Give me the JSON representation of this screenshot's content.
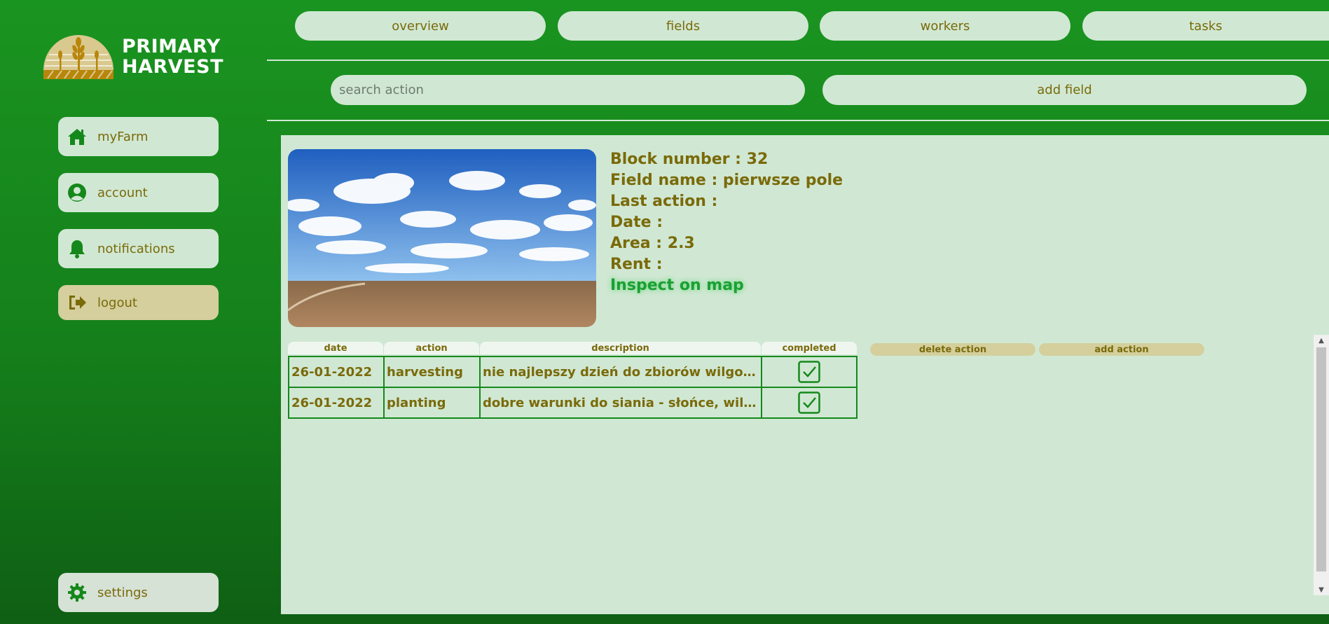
{
  "brand": {
    "line1": "PRIMARY",
    "line2": "HARVEST",
    "logo_icon": "wheat-sun-icon"
  },
  "sidebar": {
    "items": [
      {
        "label": "myFarm",
        "icon": "home-icon"
      },
      {
        "label": "account",
        "icon": "user-circle-icon"
      },
      {
        "label": "notifications",
        "icon": "bell-icon"
      },
      {
        "label": "logout",
        "icon": "sign-out-icon"
      }
    ],
    "settings": {
      "label": "settings",
      "icon": "gear-icon"
    }
  },
  "nav": {
    "tabs": [
      "overview",
      "fields",
      "workers",
      "tasks"
    ]
  },
  "toolbar": {
    "search_placeholder": "search action",
    "add_field_label": "add field"
  },
  "field": {
    "block_number": "Block number : 32",
    "field_name": "Field name : pierwsze pole",
    "last_action": "Last action :",
    "date": "Date :",
    "area": "Area : 2.3",
    "rent": "Rent :",
    "inspect_link": "Inspect on map"
  },
  "actions_table": {
    "headers": [
      "date",
      "action",
      "description",
      "completed"
    ],
    "rows": [
      {
        "date": "26-01-2022",
        "action": "harvesting",
        "description": "nie najlepszy dzień do zbiorów wilgotno...",
        "completed": true
      },
      {
        "date": "26-01-2022",
        "action": "planting",
        "description": "dobre warunki do siania - słońce, wilgot...",
        "completed": true
      }
    ],
    "delete_label": "delete action",
    "add_label": "add action"
  },
  "colors": {
    "accent_green": "#15881b",
    "text_olive": "#7a6a0a",
    "panel": "#d0e8d3",
    "tan": "#d4cf9c"
  }
}
